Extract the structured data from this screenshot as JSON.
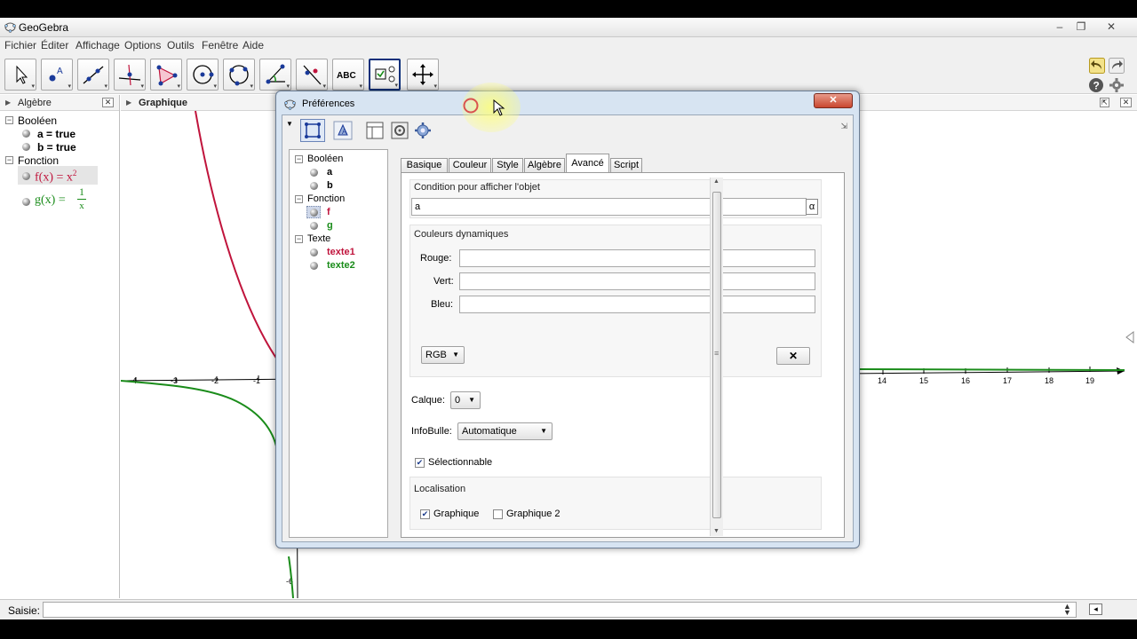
{
  "window": {
    "title": "GeoGebra"
  },
  "menu": [
    "Fichier",
    "Éditer",
    "Affichage",
    "Options",
    "Outils",
    "Fenêtre",
    "Aide"
  ],
  "toolbar": {
    "tools": [
      "move-tool",
      "point-tool",
      "line-tool",
      "perpendicular-tool",
      "polygon-tool",
      "circle-tool",
      "conic-tool",
      "angle-tool",
      "reflect-tool",
      "text-tool",
      "checkbox-tool",
      "move-graphics-tool"
    ],
    "text_tool_label": "ABC"
  },
  "algebra": {
    "title": "Algèbre",
    "groups": [
      {
        "name": "Booléen",
        "items": [
          "a = true",
          "b = true"
        ]
      },
      {
        "name": "Fonction",
        "items": [
          "f(x) = x2",
          "g(x) = 1/x"
        ]
      }
    ],
    "f": {
      "lhs": "f(x)",
      "eq": "=",
      "base": "x",
      "exp": "2"
    },
    "g": {
      "lhs": "g(x)",
      "eq": "=",
      "num": "1",
      "den": "x"
    },
    "colors": {
      "f": "#c0143c",
      "g": "#1a8c1a"
    }
  },
  "graphics": {
    "title": "Graphique",
    "ticks_left": [
      "-4",
      "-3",
      "-2",
      "-1"
    ],
    "ticks_right": [
      "14",
      "15",
      "16",
      "17",
      "18",
      "19"
    ],
    "tick_y": "-6"
  },
  "input_bar": {
    "label": "Saisie:"
  },
  "preferences": {
    "title": "Préférences",
    "tree": {
      "groups": [
        {
          "name": "Booléen",
          "items": [
            "a",
            "b"
          ]
        },
        {
          "name": "Fonction",
          "items": [
            "f",
            "g"
          ]
        },
        {
          "name": "Texte",
          "items": [
            "texte1",
            "texte2"
          ]
        }
      ]
    },
    "tabs": [
      "Basique",
      "Couleur",
      "Style",
      "Algèbre",
      "Avancé",
      "Script"
    ],
    "selected_tab": "Avancé",
    "condition": {
      "title": "Condition pour afficher l'objet",
      "value": "a",
      "alpha_button": "α"
    },
    "dynamic_colors": {
      "title": "Couleurs dynamiques",
      "red_label": "Rouge:",
      "green_label": "Vert:",
      "blue_label": "Bleu:",
      "model": "RGB",
      "clear_button": "✕"
    },
    "layer": {
      "label": "Calque:",
      "value": "0"
    },
    "tooltip": {
      "label": "InfoBulle:",
      "value": "Automatique"
    },
    "selectable": {
      "label": "Sélectionnable",
      "checked": true
    },
    "location": {
      "title": "Localisation",
      "graphics1": {
        "label": "Graphique",
        "checked": true
      },
      "graphics2": {
        "label": "Graphique 2",
        "checked": false
      }
    }
  }
}
